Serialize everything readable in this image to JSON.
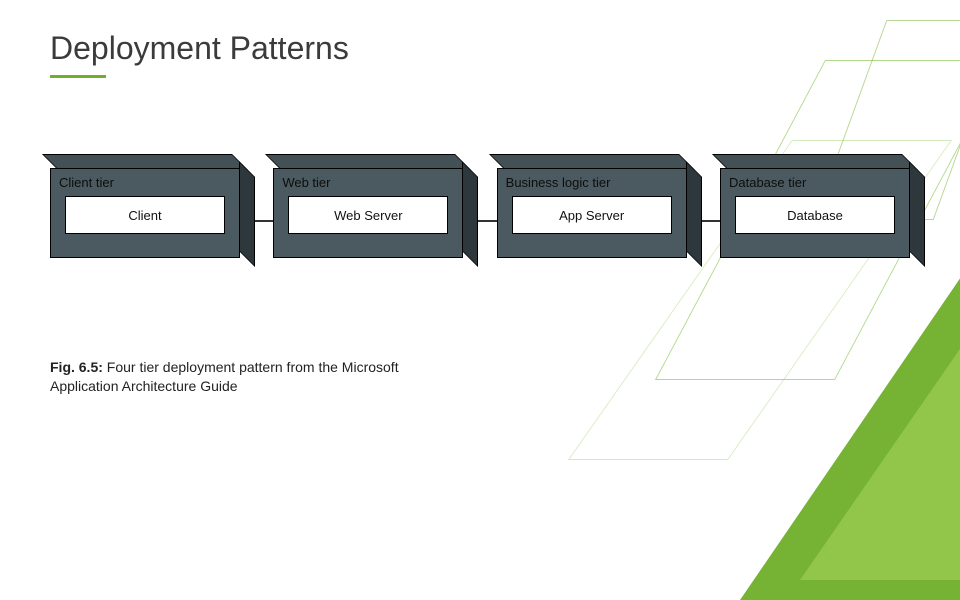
{
  "title": "Deployment Patterns",
  "tiers": [
    {
      "label": "Client tier",
      "component": "Client"
    },
    {
      "label": "Web tier",
      "component": "Web Server"
    },
    {
      "label": "Business logic tier",
      "component": "App Server"
    },
    {
      "label": "Database tier",
      "component": "Database"
    }
  ],
  "caption_prefix": "Fig. 6.5:",
  "caption_body": " Four tier deployment pattern from the Microsoft Application Architecture Guide"
}
